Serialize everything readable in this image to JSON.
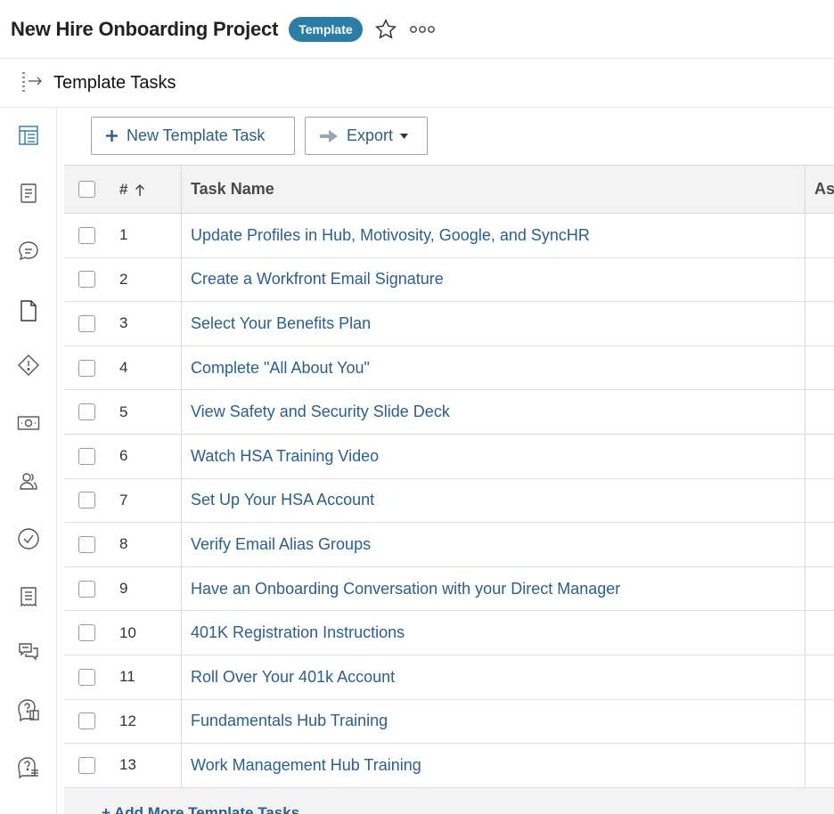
{
  "header": {
    "title": "New Hire Onboarding Project",
    "badge": "Template",
    "star_icon": "star-icon",
    "more_icon": "more-icon"
  },
  "subheader": {
    "title": "Template Tasks",
    "icon": "task-list-icon"
  },
  "leftnav": {
    "icons": [
      "task-list-nav-icon",
      "document-nav-icon",
      "comment-nav-icon",
      "file-nav-icon",
      "issue-nav-icon",
      "expense-nav-icon",
      "people-nav-icon",
      "approval-nav-icon",
      "report-nav-icon",
      "discussion-nav-icon",
      "question-doc-nav-icon",
      "question-list-nav-icon"
    ]
  },
  "toolbar": {
    "new_task_label": "New Template Task",
    "export_label": "Export"
  },
  "table": {
    "headers": {
      "num": "#",
      "name": "Task Name",
      "assign": "Assignments"
    },
    "rows": [
      {
        "num": "1",
        "name": "Update Profiles in Hub, Motivosity, Google, and SyncHR"
      },
      {
        "num": "2",
        "name": "Create a Workfront Email Signature"
      },
      {
        "num": "3",
        "name": "Select Your Benefits Plan"
      },
      {
        "num": "4",
        "name": "Complete \"All About You\""
      },
      {
        "num": "5",
        "name": "View Safety and Security Slide Deck"
      },
      {
        "num": "6",
        "name": "Watch HSA Training Video"
      },
      {
        "num": "7",
        "name": "Set Up Your HSA Account"
      },
      {
        "num": "8",
        "name": "Verify Email Alias Groups"
      },
      {
        "num": "9",
        "name": "Have an Onboarding Conversation with your Direct Manager"
      },
      {
        "num": "10",
        "name": "401K Registration Instructions"
      },
      {
        "num": "11",
        "name": "Roll Over Your 401k Account"
      },
      {
        "num": "12",
        "name": "Fundamentals Hub Training"
      },
      {
        "num": "13",
        "name": "Work Management Hub Training"
      }
    ],
    "add_more": "+ Add More Template Tasks"
  },
  "colors": {
    "accent": "#2a7ea6",
    "link": "#2b5f8f",
    "nav_active": "#2a7ea6"
  }
}
